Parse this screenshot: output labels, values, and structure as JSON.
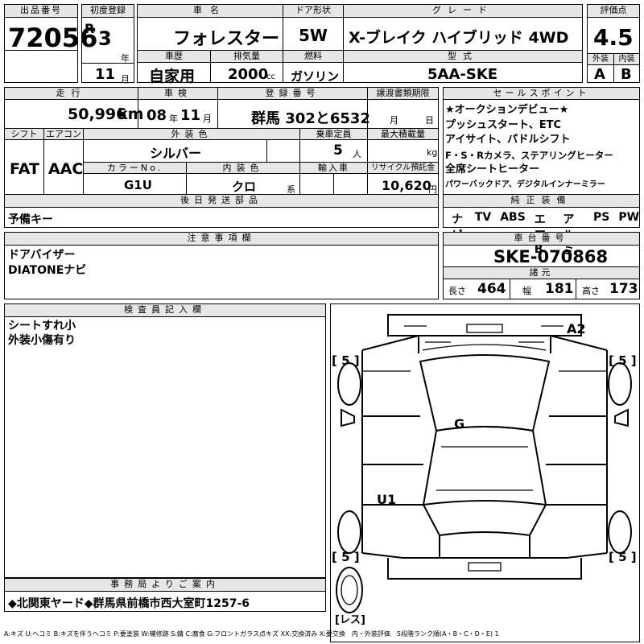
{
  "header": {
    "lot_label": "出品番号",
    "lot_no": "72056",
    "first_reg_label": "初度登録",
    "era": "R",
    "year": "3",
    "year_unit": "年",
    "month": "11",
    "month_unit": "月",
    "car_name_label": "車名",
    "car_name": "フォレスター",
    "door_label": "ドア形状",
    "door": "5W",
    "grade_label": "グレード",
    "grade": "X-ブレイク ハイブリッド 4WD",
    "score_label": "評価点",
    "score": "4.5",
    "history_label": "車歴",
    "history": "自家用",
    "displacement_label": "排気量",
    "displacement": "2000",
    "displacement_unit": "cc",
    "fuel_label": "燃料",
    "fuel": "ガソリン",
    "model_label": "型式",
    "model": "5AA-SKE",
    "exterior_label": "外装",
    "exterior_grade": "A",
    "interior_label": "内装",
    "interior_grade": "B"
  },
  "row2": {
    "mileage_label": "走行",
    "mileage": "50,996",
    "mileage_unit": "km",
    "inspection_label": "車検",
    "insp_year": "08",
    "insp_year_unit": "年",
    "insp_month": "11",
    "insp_month_unit": "月",
    "reg_no_label": "登録番号",
    "reg_no": "群馬 302と6532",
    "transfer_label": "譲渡書類期限",
    "transfer_month_unit": "月",
    "transfer_day_unit": "日",
    "shift_label": "シフト",
    "shift": "FAT",
    "ac_label": "エアコン",
    "ac": "AAC",
    "ext_color_label": "外装色",
    "ext_color": "シルバー",
    "capacity_label": "乗車定員",
    "capacity": "5",
    "capacity_unit": "人",
    "max_load_label": "最大積載量",
    "max_load_unit": "kg",
    "color_no_label": "カラーNo.",
    "color_no": "G1U",
    "int_color_label": "内装色",
    "int_color": "クロ",
    "int_color_unit": "系",
    "import_label": "輸入車",
    "recycle_label": "リサイクル預託金",
    "recycle": "10,620",
    "recycle_unit": "円"
  },
  "sales_points": {
    "label": "セールスポイント",
    "lines": [
      "★オークションデビュー★",
      "プッシュスタート、ETC",
      "アイサイト、パドルシフト",
      "F・S・Rカメラ、ステアリングヒーター",
      "全席シートヒーター",
      "パワーバックドア、デジタルインナーミラー"
    ]
  },
  "later_parts": {
    "label": "後日発送部品",
    "value": "予備キー"
  },
  "equipment": {
    "label": "純正装備",
    "items": [
      "ナビ",
      "TV",
      "ABS",
      "エアB",
      "アルミ",
      "PS",
      "PW"
    ]
  },
  "notes": {
    "label": "注意事項欄",
    "lines": [
      "ドアバイザー",
      "DIATONEナビ"
    ]
  },
  "chassis": {
    "label": "車台番号",
    "value": "SKE-070868"
  },
  "dimensions": {
    "label": "諸元",
    "length_label": "長さ",
    "length": "464",
    "width_label": "幅",
    "width": "181",
    "height_label": "高さ",
    "height": "173"
  },
  "inspector": {
    "label": "検査員記入欄",
    "lines": [
      "シートすれ小",
      "外装小傷有り"
    ]
  },
  "diagram": {
    "marks": {
      "a2": "A2",
      "g": "G",
      "u1": "U1"
    },
    "tire_fl": "[ 5 ]",
    "tire_fr": "[ 5 ]",
    "tire_rl": "[ 5 ]",
    "tire_rr": "[ 5 ]",
    "spare": "[レス]"
  },
  "office": {
    "label": "事務局よりご案内",
    "value": "◆北関東ヤード◆群馬県前橋市西大室町1257-6"
  },
  "legend": "A:キズ U:ヘコミ B:キズを伴うヘコミ P:要塗装 W:補修跡 S:錆 C:腐食 G:フロントガラス点キズ XX:交換済み X:要交換　内・外装評価　5段階ランク順(A・B・C・D・E) 1"
}
